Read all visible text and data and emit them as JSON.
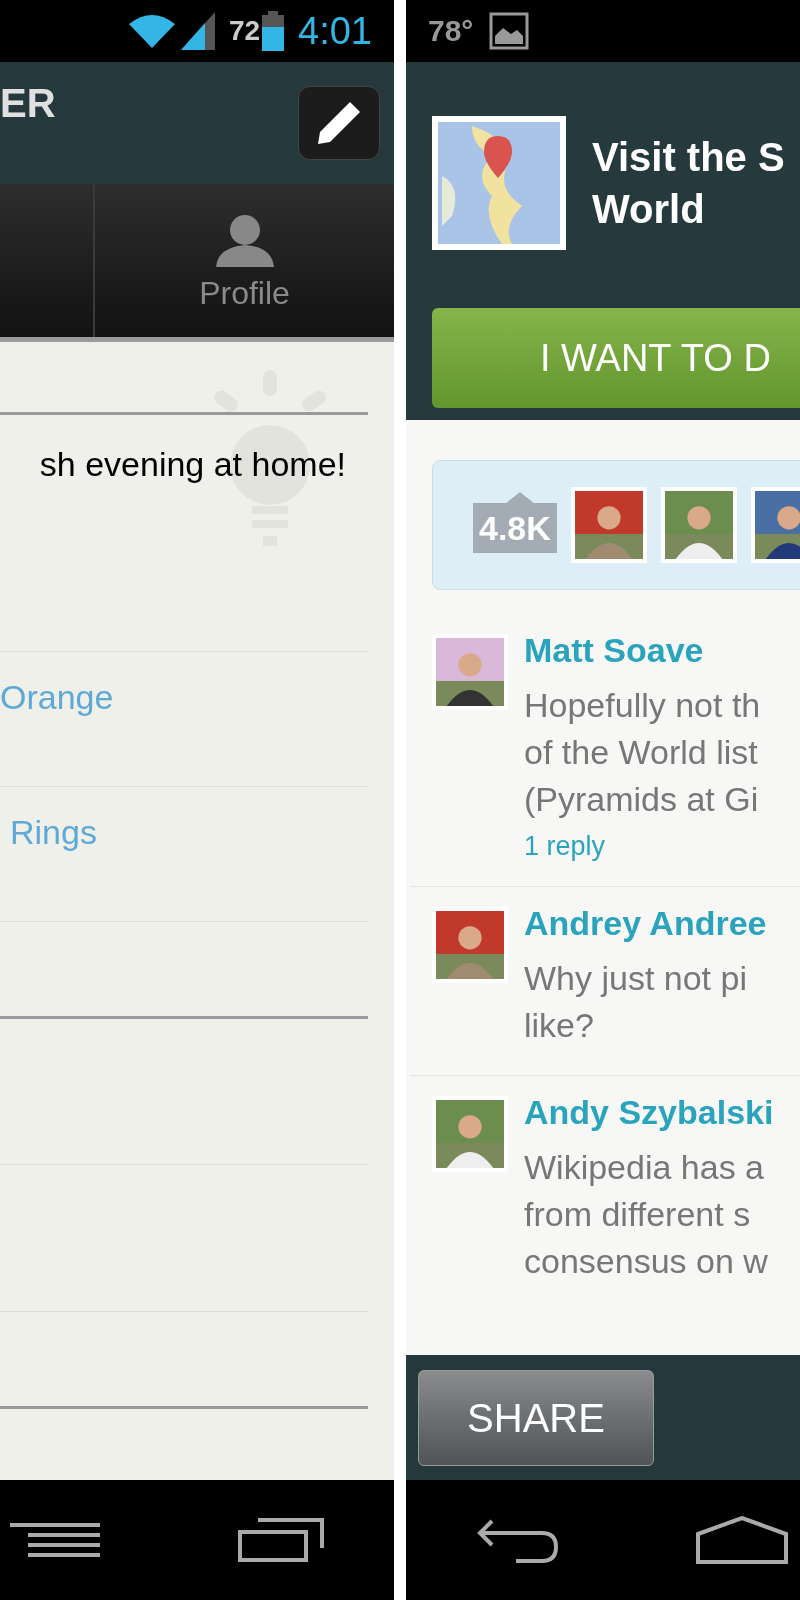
{
  "left_screen": {
    "status_bar": {
      "battery": "72",
      "time": "4:01"
    },
    "header": {
      "title": "ER"
    },
    "tabs": [
      {
        "label": "Profile",
        "selected": false
      }
    ],
    "post": {
      "text": "sh evening at home!"
    },
    "links": [
      "Orange",
      "Rings"
    ],
    "nav": [
      {
        "kind": "menu"
      },
      {
        "kind": "recents"
      }
    ]
  },
  "right_screen": {
    "status_bar": {
      "temperature": "78°"
    },
    "header": {
      "title_lines": [
        "Visit the S",
        "World"
      ],
      "action": "I WANT TO D"
    },
    "likes": {
      "count": "4.8K"
    },
    "comments": [
      {
        "author": "Matt Soave",
        "lines": [
          "Hopefully not th",
          "of the World list",
          "(Pyramids at Gi"
        ],
        "replies": "1 reply"
      },
      {
        "author": "Andrey Andree",
        "lines": [
          "Why just not pi",
          "like?"
        ]
      },
      {
        "author": "Andy Szybalski",
        "lines": [
          "Wikipedia has a",
          "from different s",
          "consensus on w"
        ]
      }
    ],
    "share": "SHARE",
    "nav": [
      {
        "kind": "back"
      },
      {
        "kind": "home"
      }
    ]
  }
}
